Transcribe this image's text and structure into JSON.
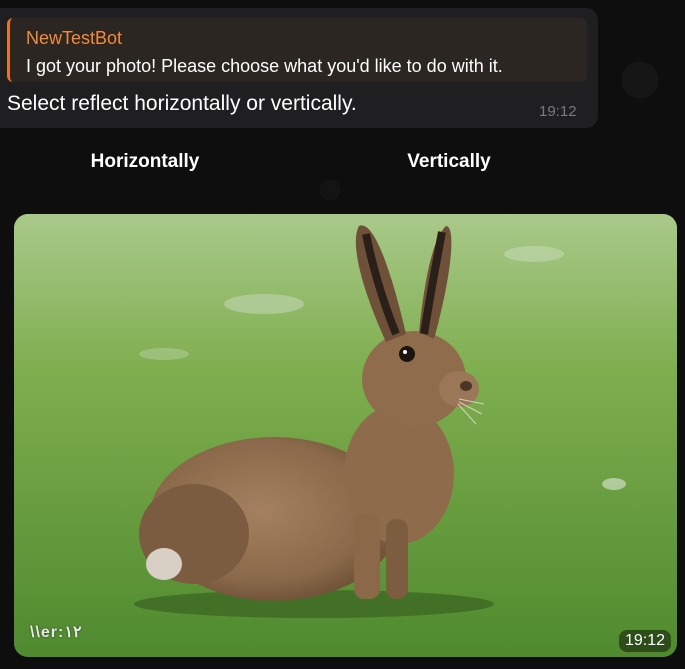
{
  "message": {
    "reply": {
      "author": "NewTestBot",
      "text": "I got your photo! Please choose what you'd like to do with it."
    },
    "text": "Select reflect horizontally or vertically.",
    "time": "19:12"
  },
  "keyboard": {
    "buttons": [
      {
        "label": "Horizontally"
      },
      {
        "label": "Vertically"
      }
    ]
  },
  "photo": {
    "watermark": "\\\\er:۱۲",
    "time": "19:12",
    "alt": "hare-sitting-on-grass",
    "colors": {
      "grass_light": "#7fae4f",
      "grass_dark": "#3f6d25",
      "fur": "#8a6a4a",
      "fur_dark": "#5e4530"
    }
  }
}
